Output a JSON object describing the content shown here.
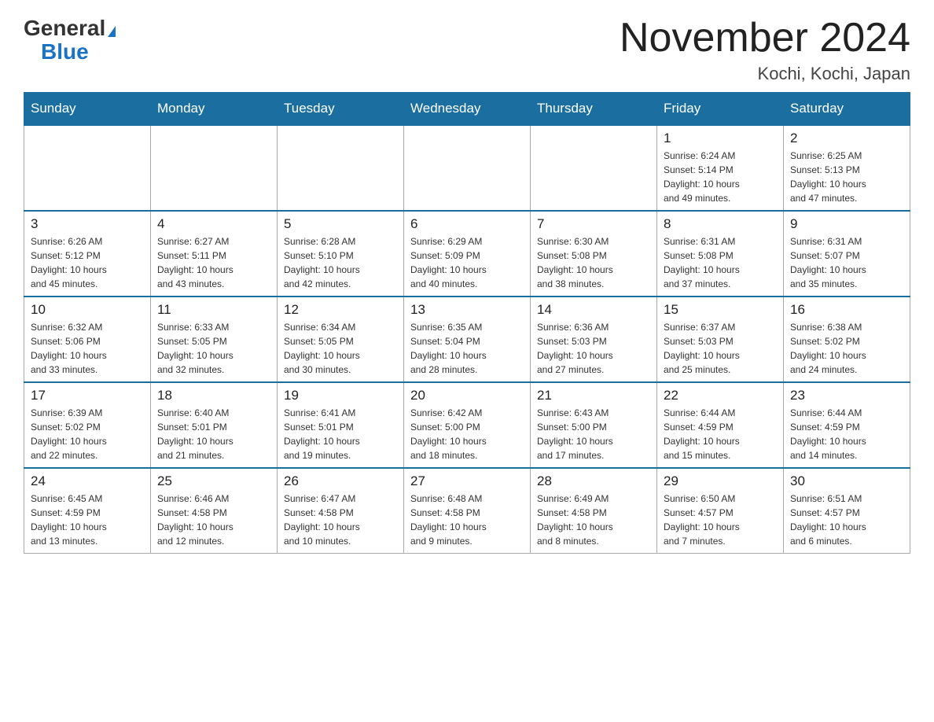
{
  "logo": {
    "general": "General",
    "blue": "Blue"
  },
  "title": "November 2024",
  "location": "Kochi, Kochi, Japan",
  "days_of_week": [
    "Sunday",
    "Monday",
    "Tuesday",
    "Wednesday",
    "Thursday",
    "Friday",
    "Saturday"
  ],
  "weeks": [
    [
      {
        "day": "",
        "info": ""
      },
      {
        "day": "",
        "info": ""
      },
      {
        "day": "",
        "info": ""
      },
      {
        "day": "",
        "info": ""
      },
      {
        "day": "",
        "info": ""
      },
      {
        "day": "1",
        "info": "Sunrise: 6:24 AM\nSunset: 5:14 PM\nDaylight: 10 hours\nand 49 minutes."
      },
      {
        "day": "2",
        "info": "Sunrise: 6:25 AM\nSunset: 5:13 PM\nDaylight: 10 hours\nand 47 minutes."
      }
    ],
    [
      {
        "day": "3",
        "info": "Sunrise: 6:26 AM\nSunset: 5:12 PM\nDaylight: 10 hours\nand 45 minutes."
      },
      {
        "day": "4",
        "info": "Sunrise: 6:27 AM\nSunset: 5:11 PM\nDaylight: 10 hours\nand 43 minutes."
      },
      {
        "day": "5",
        "info": "Sunrise: 6:28 AM\nSunset: 5:10 PM\nDaylight: 10 hours\nand 42 minutes."
      },
      {
        "day": "6",
        "info": "Sunrise: 6:29 AM\nSunset: 5:09 PM\nDaylight: 10 hours\nand 40 minutes."
      },
      {
        "day": "7",
        "info": "Sunrise: 6:30 AM\nSunset: 5:08 PM\nDaylight: 10 hours\nand 38 minutes."
      },
      {
        "day": "8",
        "info": "Sunrise: 6:31 AM\nSunset: 5:08 PM\nDaylight: 10 hours\nand 37 minutes."
      },
      {
        "day": "9",
        "info": "Sunrise: 6:31 AM\nSunset: 5:07 PM\nDaylight: 10 hours\nand 35 minutes."
      }
    ],
    [
      {
        "day": "10",
        "info": "Sunrise: 6:32 AM\nSunset: 5:06 PM\nDaylight: 10 hours\nand 33 minutes."
      },
      {
        "day": "11",
        "info": "Sunrise: 6:33 AM\nSunset: 5:05 PM\nDaylight: 10 hours\nand 32 minutes."
      },
      {
        "day": "12",
        "info": "Sunrise: 6:34 AM\nSunset: 5:05 PM\nDaylight: 10 hours\nand 30 minutes."
      },
      {
        "day": "13",
        "info": "Sunrise: 6:35 AM\nSunset: 5:04 PM\nDaylight: 10 hours\nand 28 minutes."
      },
      {
        "day": "14",
        "info": "Sunrise: 6:36 AM\nSunset: 5:03 PM\nDaylight: 10 hours\nand 27 minutes."
      },
      {
        "day": "15",
        "info": "Sunrise: 6:37 AM\nSunset: 5:03 PM\nDaylight: 10 hours\nand 25 minutes."
      },
      {
        "day": "16",
        "info": "Sunrise: 6:38 AM\nSunset: 5:02 PM\nDaylight: 10 hours\nand 24 minutes."
      }
    ],
    [
      {
        "day": "17",
        "info": "Sunrise: 6:39 AM\nSunset: 5:02 PM\nDaylight: 10 hours\nand 22 minutes."
      },
      {
        "day": "18",
        "info": "Sunrise: 6:40 AM\nSunset: 5:01 PM\nDaylight: 10 hours\nand 21 minutes."
      },
      {
        "day": "19",
        "info": "Sunrise: 6:41 AM\nSunset: 5:01 PM\nDaylight: 10 hours\nand 19 minutes."
      },
      {
        "day": "20",
        "info": "Sunrise: 6:42 AM\nSunset: 5:00 PM\nDaylight: 10 hours\nand 18 minutes."
      },
      {
        "day": "21",
        "info": "Sunrise: 6:43 AM\nSunset: 5:00 PM\nDaylight: 10 hours\nand 17 minutes."
      },
      {
        "day": "22",
        "info": "Sunrise: 6:44 AM\nSunset: 4:59 PM\nDaylight: 10 hours\nand 15 minutes."
      },
      {
        "day": "23",
        "info": "Sunrise: 6:44 AM\nSunset: 4:59 PM\nDaylight: 10 hours\nand 14 minutes."
      }
    ],
    [
      {
        "day": "24",
        "info": "Sunrise: 6:45 AM\nSunset: 4:59 PM\nDaylight: 10 hours\nand 13 minutes."
      },
      {
        "day": "25",
        "info": "Sunrise: 6:46 AM\nSunset: 4:58 PM\nDaylight: 10 hours\nand 12 minutes."
      },
      {
        "day": "26",
        "info": "Sunrise: 6:47 AM\nSunset: 4:58 PM\nDaylight: 10 hours\nand 10 minutes."
      },
      {
        "day": "27",
        "info": "Sunrise: 6:48 AM\nSunset: 4:58 PM\nDaylight: 10 hours\nand 9 minutes."
      },
      {
        "day": "28",
        "info": "Sunrise: 6:49 AM\nSunset: 4:58 PM\nDaylight: 10 hours\nand 8 minutes."
      },
      {
        "day": "29",
        "info": "Sunrise: 6:50 AM\nSunset: 4:57 PM\nDaylight: 10 hours\nand 7 minutes."
      },
      {
        "day": "30",
        "info": "Sunrise: 6:51 AM\nSunset: 4:57 PM\nDaylight: 10 hours\nand 6 minutes."
      }
    ]
  ]
}
